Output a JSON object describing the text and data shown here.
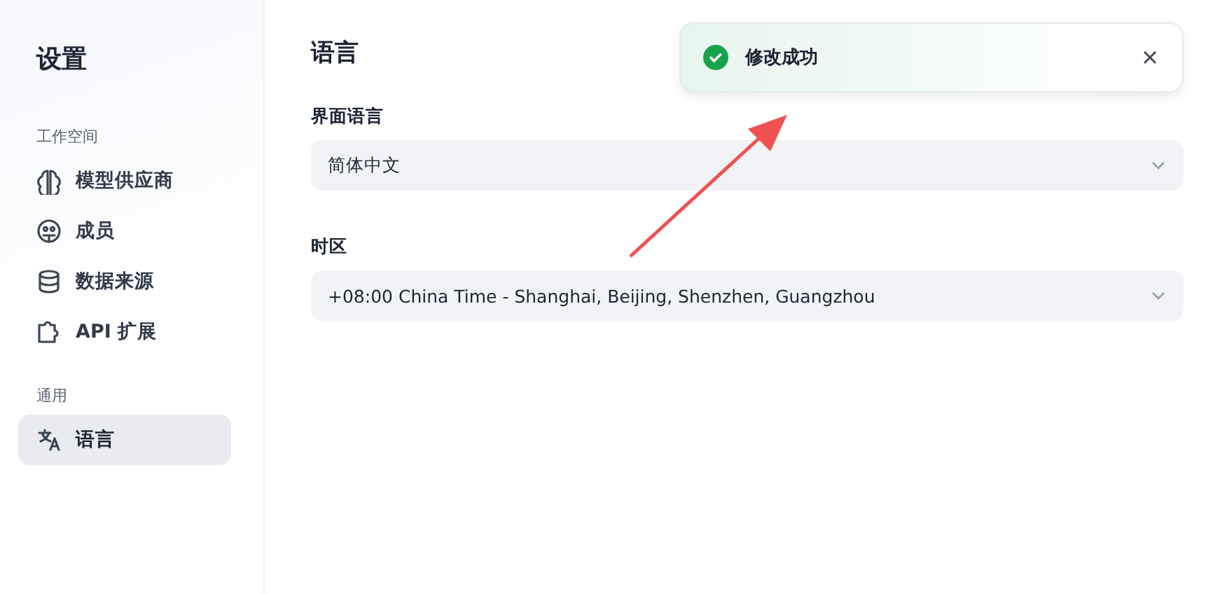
{
  "sidebar": {
    "title": "设置",
    "sections": [
      {
        "label": "工作空间",
        "items": [
          {
            "kind": "brain",
            "label": "模型供应商",
            "selected": false
          },
          {
            "kind": "members",
            "label": "成员",
            "selected": false
          },
          {
            "kind": "database",
            "label": "数据来源",
            "selected": false
          },
          {
            "kind": "puzzle",
            "label": "API 扩展",
            "selected": false
          }
        ]
      },
      {
        "label": "通用",
        "items": [
          {
            "kind": "translate",
            "label": "语言",
            "selected": true
          }
        ]
      }
    ]
  },
  "main": {
    "title": "语言",
    "fields": [
      {
        "label": "界面语言",
        "value": "简体中文"
      },
      {
        "label": "时区",
        "value": "+08:00 China Time - Shanghai, Beijing, Shenzhen, Guangzhou"
      }
    ]
  },
  "toast": {
    "kind": "success",
    "message": "修改成功"
  }
}
